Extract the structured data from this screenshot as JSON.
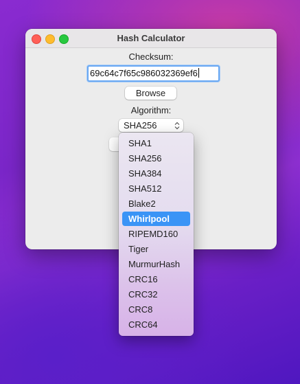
{
  "window": {
    "title": "Hash Calculator"
  },
  "form": {
    "checksum_label": "Checksum:",
    "checksum_value": "69c64c7f65c986032369ef6",
    "browse_label": "Browse",
    "algorithm_label": "Algorithm:",
    "algorithm_selected": "SHA256",
    "select_chevron": "⌃⌄"
  },
  "menu": {
    "items": [
      "SHA1",
      "SHA256",
      "SHA384",
      "SHA512",
      "Blake2",
      "Whirlpool",
      "RIPEMD160",
      "Tiger",
      "MurmurHash",
      "CRC16",
      "CRC32",
      "CRC8",
      "CRC64"
    ],
    "highlighted": "Whirlpool"
  },
  "colors": {
    "highlight": "#3a94f6",
    "focus_ring": "#6aa8f2",
    "close": "#ff5f57",
    "minimize": "#febc2e",
    "maximize": "#28c840"
  }
}
